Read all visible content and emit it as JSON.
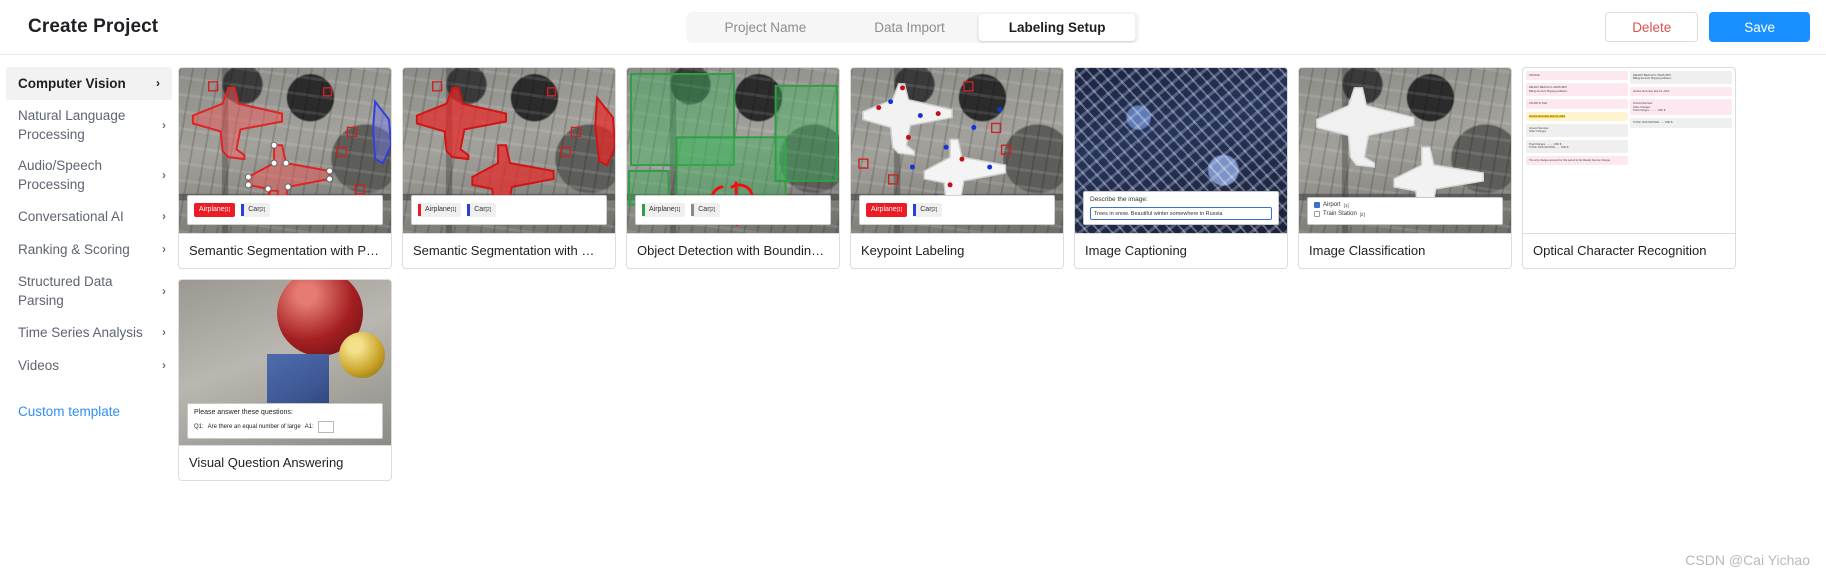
{
  "header": {
    "title": "Create Project",
    "steps": [
      {
        "label": "Project Name",
        "active": false
      },
      {
        "label": "Data Import",
        "active": false
      },
      {
        "label": "Labeling Setup",
        "active": true
      }
    ],
    "delete_label": "Delete",
    "save_label": "Save",
    "delete_color": "#d9534f",
    "save_color": "#1890ff"
  },
  "sidebar": {
    "items": [
      {
        "label": "Computer Vision",
        "active": true,
        "chevron": "›"
      },
      {
        "label": "Natural Language Processing",
        "active": false,
        "chevron": "›"
      },
      {
        "label": "Audio/Speech Processing",
        "active": false,
        "chevron": "›"
      },
      {
        "label": "Conversational AI",
        "active": false,
        "chevron": "›"
      },
      {
        "label": "Ranking & Scoring",
        "active": false,
        "chevron": "›"
      },
      {
        "label": "Structured Data Parsing",
        "active": false,
        "chevron": "›"
      },
      {
        "label": "Time Series Analysis",
        "active": false,
        "chevron": "›"
      },
      {
        "label": "Videos",
        "active": false,
        "chevron": "›"
      }
    ],
    "custom_template_label": "Custom template",
    "custom_template_color": "#2f8ef4"
  },
  "cards": [
    {
      "title": "Semantic Segmentation with Polygons",
      "kind": "aerial",
      "labels": [
        {
          "text": "Airplane",
          "hotkey": "[1]",
          "style": "solid-red",
          "color": "#ec1c24"
        },
        {
          "text": "Car",
          "hotkey": "[2]",
          "style": "bar",
          "color": "#2b3fd4"
        }
      ]
    },
    {
      "title": "Semantic Segmentation with Masks",
      "kind": "aerial",
      "labels": [
        {
          "text": "Airplane",
          "hotkey": "[1]",
          "style": "bar",
          "color": "#ec1c24"
        },
        {
          "text": "Car",
          "hotkey": "[2]",
          "style": "bar",
          "color": "#2b3fd4"
        }
      ]
    },
    {
      "title": "Object Detection with Bounding Boxes",
      "kind": "aerial-green",
      "labels": [
        {
          "text": "Airplane",
          "hotkey": "[1]",
          "style": "bar",
          "color": "#2f9e44"
        },
        {
          "text": "Car",
          "hotkey": "[2]",
          "style": "bar",
          "color": "#8a8a8a"
        }
      ]
    },
    {
      "title": "Keypoint Labeling",
      "kind": "aerial-keypoint",
      "labels": [
        {
          "text": "Airplane",
          "hotkey": "[1]",
          "style": "solid-red",
          "color": "#ec1c24"
        },
        {
          "text": "Car",
          "hotkey": "[2]",
          "style": "bar",
          "color": "#2b3fd4"
        }
      ]
    },
    {
      "title": "Image Captioning",
      "kind": "snow",
      "caption_prompt": "Describe the image:",
      "caption_value": "Trees in snow. Beautiful winter somewhere in Russia"
    },
    {
      "title": "Image Classification",
      "kind": "aerial",
      "choices": [
        {
          "label": "Airport",
          "hotkey": "[1]",
          "checked": true
        },
        {
          "label": "Train Station",
          "hotkey": "[2]",
          "checked": false
        }
      ]
    },
    {
      "title": "Optical Character Recognition",
      "kind": "document",
      "doc_lines": [
        "INVOICE",
        "DELRAY BEACH FL 33445-3897",
        "Billing Account Shipping Address:",
        "ATLANTIC AVE",
        "Invoice Summary Sep 01, 2014",
        "Ground Services",
        "Other Charges",
        "Total Charges .......... USD $",
        "TOTAL THIS INVOICE ...... USD $",
        "The only charges account for this period is the Weekly Service Charge."
      ]
    },
    {
      "title": "Visual Question Answering",
      "kind": "vqa",
      "question_prompt": "Please answer these questions:",
      "q_label": "Q1:",
      "q_text": "Are there an equal number of large",
      "a_label": "A1:"
    }
  ],
  "watermark": "CSDN @Cai Yichao"
}
